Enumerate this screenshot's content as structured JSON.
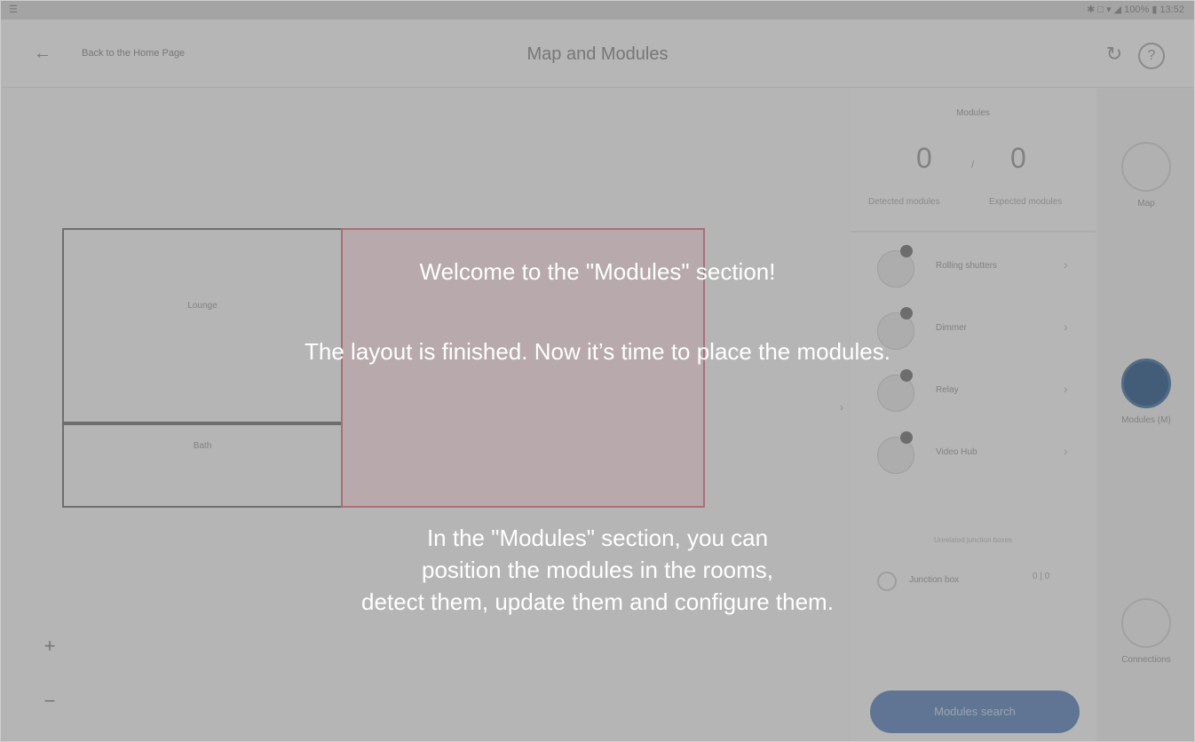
{
  "status_bar": {
    "left_text": "☰",
    "right_text": "✱ □ ▾ ◢ 100% ▮ 13:52"
  },
  "header": {
    "back_label": "Back to the Home Page",
    "title": "Map and Modules"
  },
  "map": {
    "rooms": [
      "Lounge",
      "Bath",
      ""
    ],
    "zoom_in": "+",
    "zoom_out": "−"
  },
  "modules_panel": {
    "title": "Modules",
    "detected_count": "0",
    "separator": "/",
    "expected_count": "0",
    "detected_label": "Detected modules",
    "expected_label": "Expected modules",
    "items": [
      {
        "label": "Rolling shutters"
      },
      {
        "label": "Dimmer"
      },
      {
        "label": "Relay"
      },
      {
        "label": "Video Hub"
      }
    ],
    "junction_label": "Unrelated junction boxes",
    "junction_name": "Junction box",
    "junction_count": "0 | 0",
    "search_button": "Modules search"
  },
  "right_rail": {
    "map_label": "Map",
    "modules_label": "Modules (M)",
    "connections_label": "Connections"
  },
  "tutorial": {
    "welcome": "Welcome to the \"Modules\" section!",
    "layout_done": "The layout is finished. Now it’s time to place the modules.",
    "section_line1": "In the \"Modules\" section, you can",
    "section_line2": "position the modules in the rooms,",
    "section_line3": "detect them, update them and configure them."
  },
  "colors": {
    "overlay": "#5f5f5f",
    "accent": "#2f5a8a",
    "room_highlight": "#e07b88"
  }
}
